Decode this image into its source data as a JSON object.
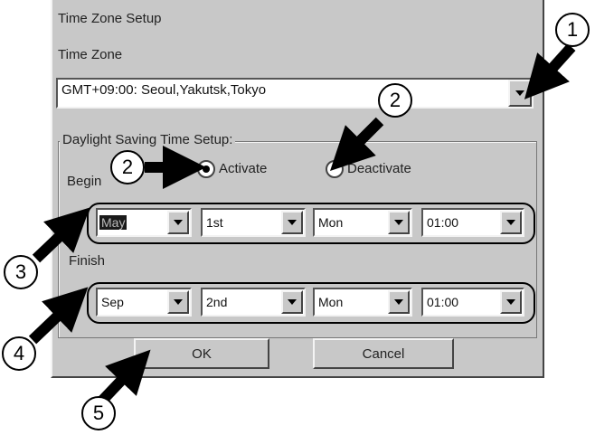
{
  "dialog": {
    "title": "Time Zone Setup",
    "tz_label": "Time Zone",
    "tz_value": "GMT+09:00: Seoul,Yakutsk,Tokyo",
    "dst_group": "Daylight Saving Time Setup:",
    "activate_label": "Activate",
    "deactivate_label": "Deactivate",
    "activate_selected": true,
    "begin_label": "Begin",
    "finish_label": "Finish",
    "begin": {
      "month": "May",
      "week": "1st",
      "day": "Mon",
      "time": "01:00"
    },
    "finish": {
      "month": "Sep",
      "week": "2nd",
      "day": "Mon",
      "time": "01:00"
    },
    "ok_label": "OK",
    "cancel_label": "Cancel"
  },
  "callouts": [
    "1",
    "2",
    "2",
    "3",
    "4",
    "5"
  ]
}
